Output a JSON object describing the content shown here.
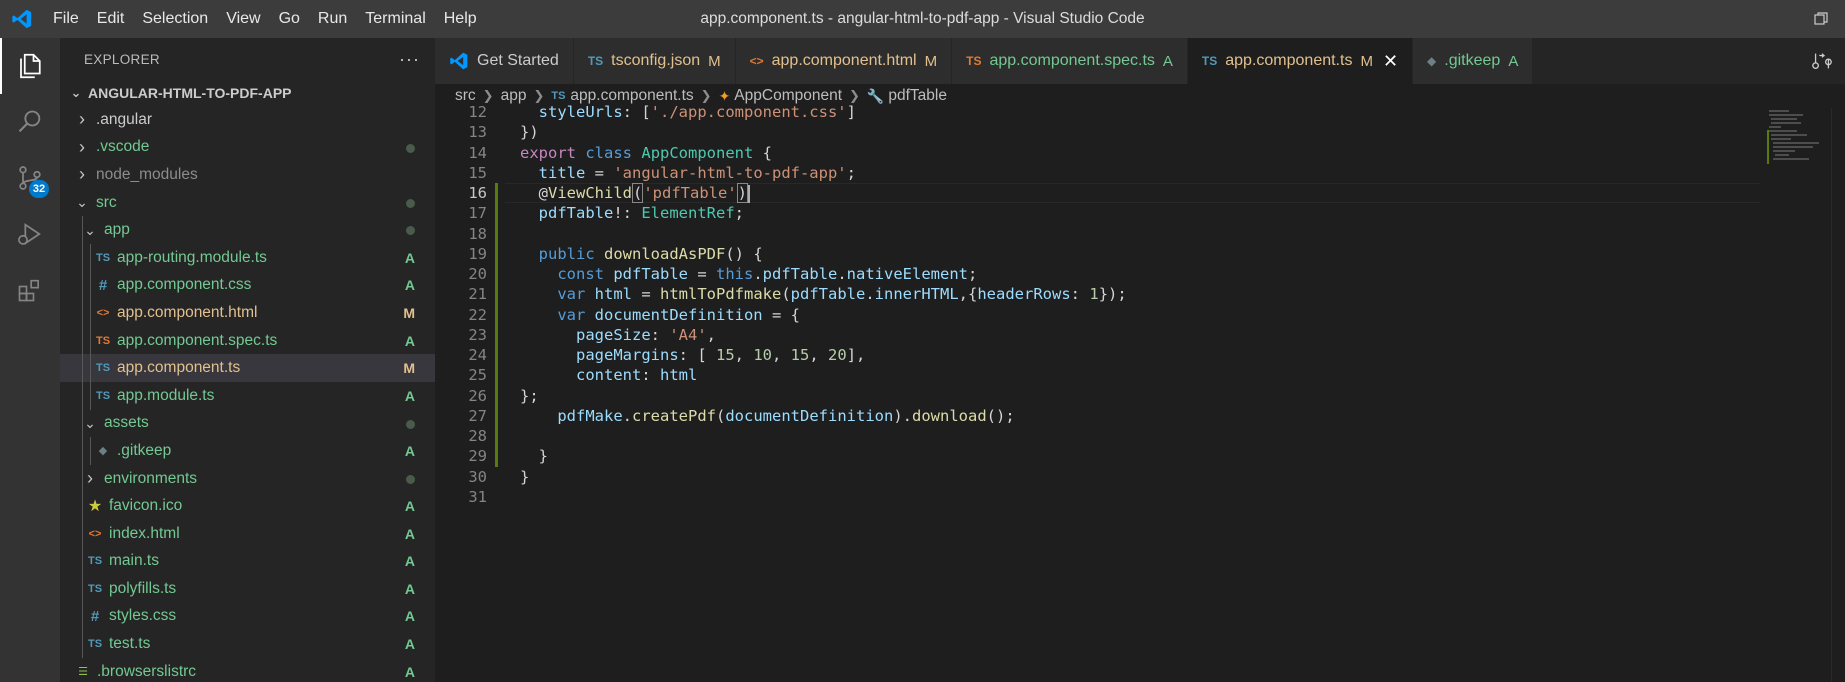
{
  "window": {
    "title": "app.component.ts - angular-html-to-pdf-app - Visual Studio Code",
    "menu": [
      "File",
      "Edit",
      "Selection",
      "View",
      "Go",
      "Run",
      "Terminal",
      "Help"
    ]
  },
  "activity_bar": {
    "items": [
      "explorer-icon",
      "search-icon",
      "source-control-icon",
      "run-debug-icon",
      "extensions-icon"
    ],
    "scm_badge": "32"
  },
  "sidebar": {
    "title": "EXPLORER",
    "more": "···",
    "section": "ANGULAR-HTML-TO-PDF-APP",
    "tree": [
      {
        "label": ".angular",
        "type": "folder",
        "depth": 0,
        "expanded": false,
        "status": "",
        "color": "#cccccc"
      },
      {
        "label": ".vscode",
        "type": "folder",
        "depth": 0,
        "expanded": false,
        "status": "dot",
        "color": "#73c991"
      },
      {
        "label": "node_modules",
        "type": "folder",
        "depth": 0,
        "expanded": false,
        "status": "",
        "color": "#8c8c8c"
      },
      {
        "label": "src",
        "type": "folder",
        "depth": 0,
        "expanded": true,
        "status": "dot",
        "color": "#73c991"
      },
      {
        "label": "app",
        "type": "folder",
        "depth": 1,
        "expanded": true,
        "status": "dot",
        "color": "#73c991"
      },
      {
        "label": "app-routing.module.ts",
        "type": "ts",
        "depth": 2,
        "status": "A",
        "color": "#73c991"
      },
      {
        "label": "app.component.css",
        "type": "css",
        "depth": 2,
        "status": "A",
        "color": "#73c991"
      },
      {
        "label": "app.component.html",
        "type": "html",
        "depth": 2,
        "status": "M",
        "color": "#e2c08d"
      },
      {
        "label": "app.component.spec.ts",
        "type": "spec",
        "depth": 2,
        "status": "A",
        "color": "#73c991"
      },
      {
        "label": "app.component.ts",
        "type": "ts",
        "depth": 2,
        "status": "M",
        "color": "#e2c08d",
        "selected": true
      },
      {
        "label": "app.module.ts",
        "type": "ts",
        "depth": 2,
        "status": "A",
        "color": "#73c991"
      },
      {
        "label": "assets",
        "type": "folder",
        "depth": 1,
        "expanded": true,
        "status": "dot",
        "color": "#73c991"
      },
      {
        "label": ".gitkeep",
        "type": "git",
        "depth": 2,
        "status": "A",
        "color": "#73c991"
      },
      {
        "label": "environments",
        "type": "folder",
        "depth": 1,
        "expanded": false,
        "status": "dot",
        "color": "#73c991"
      },
      {
        "label": "favicon.ico",
        "type": "star",
        "depth": 1,
        "status": "A",
        "color": "#73c991"
      },
      {
        "label": "index.html",
        "type": "html",
        "depth": 1,
        "status": "A",
        "color": "#73c991"
      },
      {
        "label": "main.ts",
        "type": "ts",
        "depth": 1,
        "status": "A",
        "color": "#73c991"
      },
      {
        "label": "polyfills.ts",
        "type": "ts",
        "depth": 1,
        "status": "A",
        "color": "#73c991"
      },
      {
        "label": "styles.css",
        "type": "css",
        "depth": 1,
        "status": "A",
        "color": "#73c991"
      },
      {
        "label": "test.ts",
        "type": "ts",
        "depth": 1,
        "status": "A",
        "color": "#73c991"
      },
      {
        "label": ".browserslistrc",
        "type": "list",
        "depth": 0,
        "status": "A",
        "color": "#73c991"
      }
    ]
  },
  "tabs": [
    {
      "label": "Get Started",
      "icon": "vscode-icon",
      "marker": "",
      "color": "#cccccc",
      "active": false
    },
    {
      "label": "tsconfig.json",
      "icon": "ts",
      "marker": "M",
      "color": "#e2c08d",
      "active": false
    },
    {
      "label": "app.component.html",
      "icon": "html",
      "marker": "M",
      "color": "#e2c08d",
      "active": false
    },
    {
      "label": "app.component.spec.ts",
      "icon": "spec",
      "marker": "A",
      "color": "#73c991",
      "active": false
    },
    {
      "label": "app.component.ts",
      "icon": "ts",
      "marker": "M",
      "color": "#e2c08d",
      "active": true
    },
    {
      "label": ".gitkeep",
      "icon": "git",
      "marker": "A",
      "color": "#73c991",
      "active": false
    }
  ],
  "breadcrumb": [
    "src",
    "app",
    "app.component.ts",
    "AppComponent",
    "pdfTable"
  ],
  "editor": {
    "current_line": 16,
    "lines": [
      {
        "n": "12",
        "mod": false,
        "tokens": [
          [
            "p",
            "  "
          ],
          [
            "v",
            "styleUrls"
          ],
          [
            "p",
            ": ["
          ],
          [
            "s",
            "'./app.component.css'"
          ],
          [
            "p",
            "]"
          ]
        ]
      },
      {
        "n": "13",
        "mod": false,
        "tokens": [
          [
            "p",
            "})"
          ]
        ]
      },
      {
        "n": "14",
        "mod": false,
        "tokens": [
          [
            "kc",
            "export"
          ],
          [
            "p",
            " "
          ],
          [
            "k",
            "class"
          ],
          [
            "p",
            " "
          ],
          [
            "cls",
            "AppComponent"
          ],
          [
            "p",
            " {"
          ]
        ]
      },
      {
        "n": "15",
        "mod": false,
        "tokens": [
          [
            "p",
            "  "
          ],
          [
            "v",
            "title"
          ],
          [
            "p",
            " = "
          ],
          [
            "s",
            "'angular-html-to-pdf-app'"
          ],
          [
            "p",
            ";"
          ]
        ]
      },
      {
        "n": "16",
        "mod": true,
        "tokens": [
          [
            "p",
            "  @"
          ],
          [
            "fn",
            "ViewChild"
          ],
          [
            "brk",
            "("
          ],
          [
            "s",
            "'pdfTable'"
          ],
          [
            "brk",
            ")"
          ],
          [
            "cursor",
            ""
          ]
        ]
      },
      {
        "n": "17",
        "mod": true,
        "tokens": [
          [
            "p",
            "  "
          ],
          [
            "v",
            "pdfTable"
          ],
          [
            "p",
            "!: "
          ],
          [
            "cls",
            "ElementRef"
          ],
          [
            "p",
            ";"
          ]
        ]
      },
      {
        "n": "18",
        "mod": true,
        "tokens": []
      },
      {
        "n": "19",
        "mod": true,
        "tokens": [
          [
            "p",
            "  "
          ],
          [
            "k",
            "public"
          ],
          [
            "p",
            " "
          ],
          [
            "fn",
            "downloadAsPDF"
          ],
          [
            "p",
            "() {"
          ]
        ]
      },
      {
        "n": "20",
        "mod": true,
        "tokens": [
          [
            "p",
            "    "
          ],
          [
            "k",
            "const"
          ],
          [
            "p",
            " "
          ],
          [
            "v",
            "pdfTable"
          ],
          [
            "p",
            " = "
          ],
          [
            "k",
            "this"
          ],
          [
            "p",
            "."
          ],
          [
            "v",
            "pdfTable"
          ],
          [
            "p",
            "."
          ],
          [
            "v",
            "nativeElement"
          ],
          [
            "p",
            ";"
          ]
        ]
      },
      {
        "n": "21",
        "mod": true,
        "tokens": [
          [
            "p",
            "    "
          ],
          [
            "k",
            "var"
          ],
          [
            "p",
            " "
          ],
          [
            "v",
            "html"
          ],
          [
            "p",
            " = "
          ],
          [
            "fn",
            "htmlToPdfmake"
          ],
          [
            "p",
            "("
          ],
          [
            "v",
            "pdfTable"
          ],
          [
            "p",
            "."
          ],
          [
            "v",
            "innerHTML"
          ],
          [
            "p",
            ",{"
          ],
          [
            "v",
            "headerRows"
          ],
          [
            "p",
            ": "
          ],
          [
            "n",
            "1"
          ],
          [
            "p",
            "});"
          ]
        ]
      },
      {
        "n": "22",
        "mod": true,
        "tokens": [
          [
            "p",
            "    "
          ],
          [
            "k",
            "var"
          ],
          [
            "p",
            " "
          ],
          [
            "v",
            "documentDefinition"
          ],
          [
            "p",
            " = {"
          ]
        ]
      },
      {
        "n": "23",
        "mod": true,
        "tokens": [
          [
            "p",
            "      "
          ],
          [
            "v",
            "pageSize"
          ],
          [
            "p",
            ": "
          ],
          [
            "s",
            "'A4'"
          ],
          [
            "p",
            ","
          ]
        ]
      },
      {
        "n": "24",
        "mod": true,
        "tokens": [
          [
            "p",
            "      "
          ],
          [
            "v",
            "pageMargins"
          ],
          [
            "p",
            ": [ "
          ],
          [
            "n",
            "15"
          ],
          [
            "p",
            ", "
          ],
          [
            "n",
            "10"
          ],
          [
            "p",
            ", "
          ],
          [
            "n",
            "15"
          ],
          [
            "p",
            ", "
          ],
          [
            "n",
            "20"
          ],
          [
            "p",
            "],"
          ]
        ]
      },
      {
        "n": "25",
        "mod": true,
        "tokens": [
          [
            "p",
            "      "
          ],
          [
            "v",
            "content"
          ],
          [
            "p",
            ": "
          ],
          [
            "v",
            "html"
          ]
        ]
      },
      {
        "n": "26",
        "mod": true,
        "tokens": [
          [
            "p",
            "};"
          ]
        ]
      },
      {
        "n": "27",
        "mod": true,
        "tokens": [
          [
            "p",
            "    "
          ],
          [
            "v",
            "pdfMake"
          ],
          [
            "p",
            "."
          ],
          [
            "fn",
            "createPdf"
          ],
          [
            "p",
            "("
          ],
          [
            "v",
            "documentDefinition"
          ],
          [
            "p",
            ")."
          ],
          [
            "fn",
            "download"
          ],
          [
            "p",
            "();"
          ]
        ]
      },
      {
        "n": "28",
        "mod": true,
        "tokens": []
      },
      {
        "n": "29",
        "mod": true,
        "tokens": [
          [
            "p",
            "  }"
          ]
        ]
      },
      {
        "n": "30",
        "mod": false,
        "tokens": [
          [
            "p",
            "}"
          ]
        ]
      },
      {
        "n": "31",
        "mod": false,
        "tokens": []
      }
    ]
  }
}
